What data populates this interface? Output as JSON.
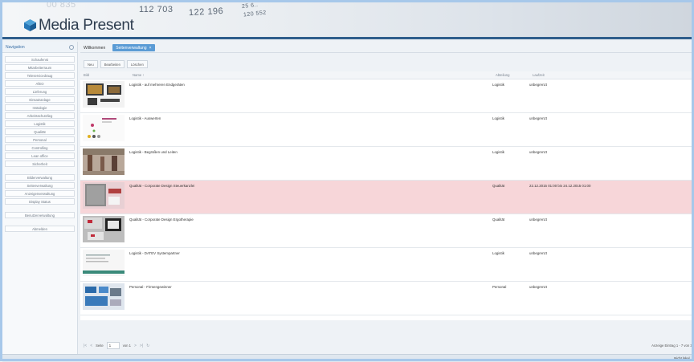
{
  "header": {
    "logo_text": "Media Present",
    "background_numbers": [
      "00 835",
      "112 703",
      "122 196",
      "25 6..",
      "120 552"
    ]
  },
  "sidebar": {
    "title": "Navigation",
    "items": [
      "Schaufenst",
      "Mitarbeiterraum",
      "Teleservicedraug",
      "AfEO",
      "Lieferung",
      "Einsatzanlage",
      "Instalogie",
      "Arbeitsschutzlieg",
      "Logistik",
      "Qualität",
      "Personal",
      "Controlling",
      "Lean office",
      "Sicherheit"
    ],
    "group2": [
      "Bilderverwaltung",
      "Seitenverwaltung",
      "Anzeigenverwaltung",
      "Display Status"
    ],
    "group3": [
      "Benutzerverwaltung"
    ],
    "group4": [
      "Abmelden"
    ]
  },
  "tabs": {
    "welcome": "Willkommen",
    "active": "Seitenverwaltung",
    "close": "×"
  },
  "toolbar": {
    "new": "Neu",
    "edit": "Bearbeiten",
    "delete": "Löschen"
  },
  "grid": {
    "columns": {
      "image": "Bild",
      "name": "Name ↑",
      "department": "Abteilung",
      "runtime": "Laufzeit"
    },
    "rows": [
      {
        "name": "Logistik - auf mehreren Endgeräten",
        "department": "Logistik",
        "runtime": "unbegrenzt",
        "highlight": false
      },
      {
        "name": "Logistik - Auswerten",
        "department": "Logistik",
        "runtime": "unbegrenzt",
        "highlight": false
      },
      {
        "name": "Logistik - Begrüßen und Leiten",
        "department": "Logistik",
        "runtime": "unbegrenzt",
        "highlight": false
      },
      {
        "name": "Qualität - Corporate Design Steuerkanzlei",
        "department": "Qualität",
        "runtime": "22.12.2015 01:00 bis 24.12.2015 01:00",
        "highlight": true
      },
      {
        "name": "Qualität - Corporate Design Ergotherapie",
        "department": "Qualität",
        "runtime": "unbegrenzt",
        "highlight": false
      },
      {
        "name": "Logistik - DATEV Systempartner",
        "department": "Logistik",
        "runtime": "unbegrenzt",
        "highlight": false
      },
      {
        "name": "Personal - Firmengewinner",
        "department": "Personal",
        "runtime": "unbegrenzt",
        "highlight": false
      }
    ]
  },
  "pager": {
    "page_label": "Seite",
    "page_value": "1",
    "of_label": "von 1",
    "info": "Anzeige Eintrag 1 - 7 von 32"
  },
  "status": {
    "text": "Nicht lokal..."
  },
  "colors": {
    "accent": "#5a9bd5",
    "highlight_row": "#f7d6d9",
    "header_rule": "#2f5e8c",
    "frame": "#a7c8ea"
  }
}
